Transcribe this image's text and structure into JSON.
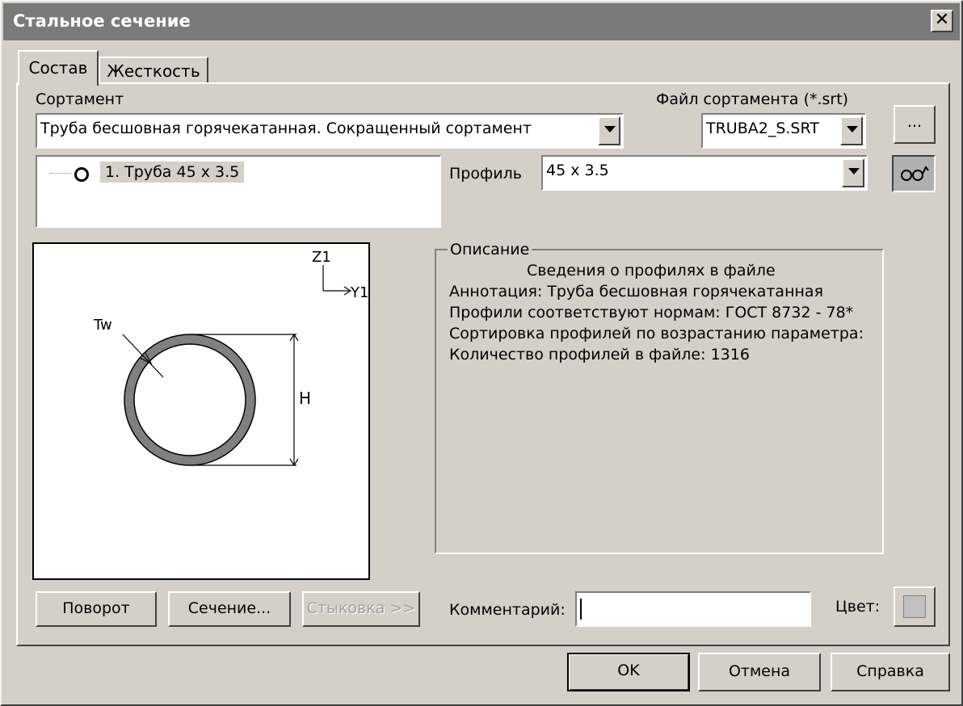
{
  "window": {
    "title": "Стальное сечение",
    "close_glyph": "✕"
  },
  "tabs": [
    {
      "label": "Состав",
      "active": true
    },
    {
      "label": "Жесткость",
      "active": false
    }
  ],
  "sortament": {
    "label": "Сортамент",
    "selected": "Труба  бесшовная  горячекатанная. Сокращенный  сортамент"
  },
  "file": {
    "label": "Файл сортамента (*.srt)",
    "selected": "TRUBA2_S.SRT",
    "browse_label": "..."
  },
  "tree": {
    "items": [
      {
        "label": "1. Труба 45 x 3.5"
      }
    ]
  },
  "profile": {
    "label": "Профиль",
    "selected": "45 x 3.5"
  },
  "view_button_icon": "glasses-icon",
  "drawing": {
    "axis_z": "Z1",
    "axis_y": "Y1",
    "tw_label": "Tw",
    "h_label": "H",
    "pipe_color": "#808080"
  },
  "description": {
    "legend": "Описание",
    "header": "Сведения о профилях в файле",
    "lines": [
      "Аннотация: Труба  бесшовная  горячекатанная",
      "Профили соответствуют нормам: ГОСТ  8732 - 78*",
      "Сортировка профилей по возрастанию параметра:",
      "Количество профилей в файле: 1316"
    ]
  },
  "buttons": {
    "rotate": "Поворот",
    "section": "Сечение...",
    "join": "Стыковка >>",
    "ok": "OK",
    "cancel": "Отмена",
    "help": "Справка"
  },
  "comment": {
    "label": "Комментарий:",
    "value": ""
  },
  "color": {
    "label": "Цвет:",
    "swatch": "#c0c0c0"
  }
}
